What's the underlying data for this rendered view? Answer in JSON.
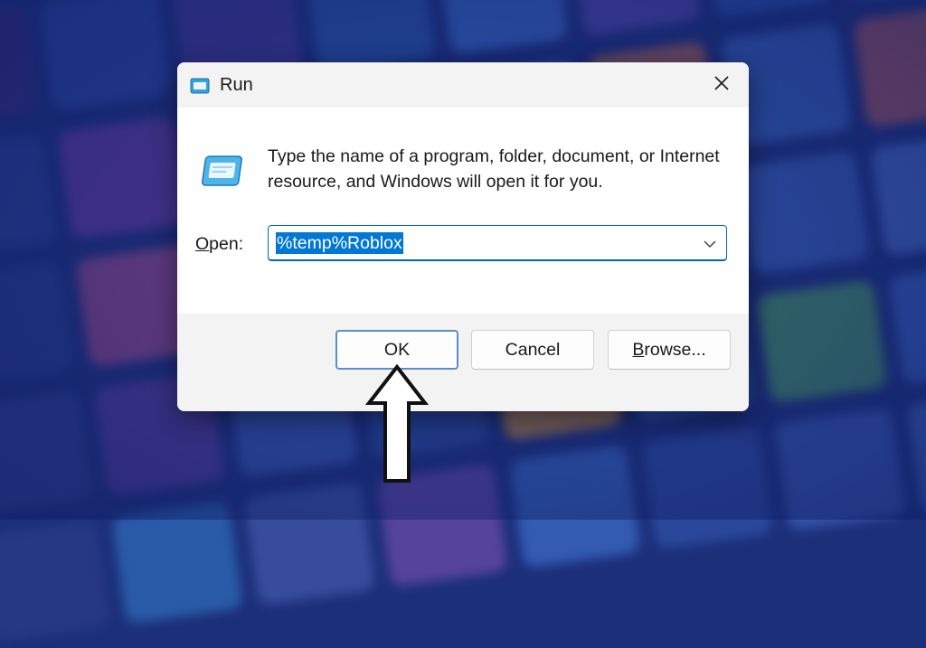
{
  "dialog": {
    "title": "Run",
    "description": "Type the name of a program, folder, document, or Internet resource, and Windows will open it for you.",
    "open_label_prefix": "O",
    "open_label_rest": "pen:",
    "open_value": "%temp%Roblox",
    "buttons": {
      "ok": "OK",
      "cancel": "Cancel",
      "browse_prefix": "B",
      "browse_rest": "rowse..."
    }
  },
  "colors": {
    "accent": "#0078d4",
    "background": "#1c2f7a",
    "dialog_bg": "#f3f3f3"
  },
  "icons": [
    "run-app-icon",
    "close-icon",
    "chevron-down-icon",
    "up-arrow-pointer-icon"
  ]
}
